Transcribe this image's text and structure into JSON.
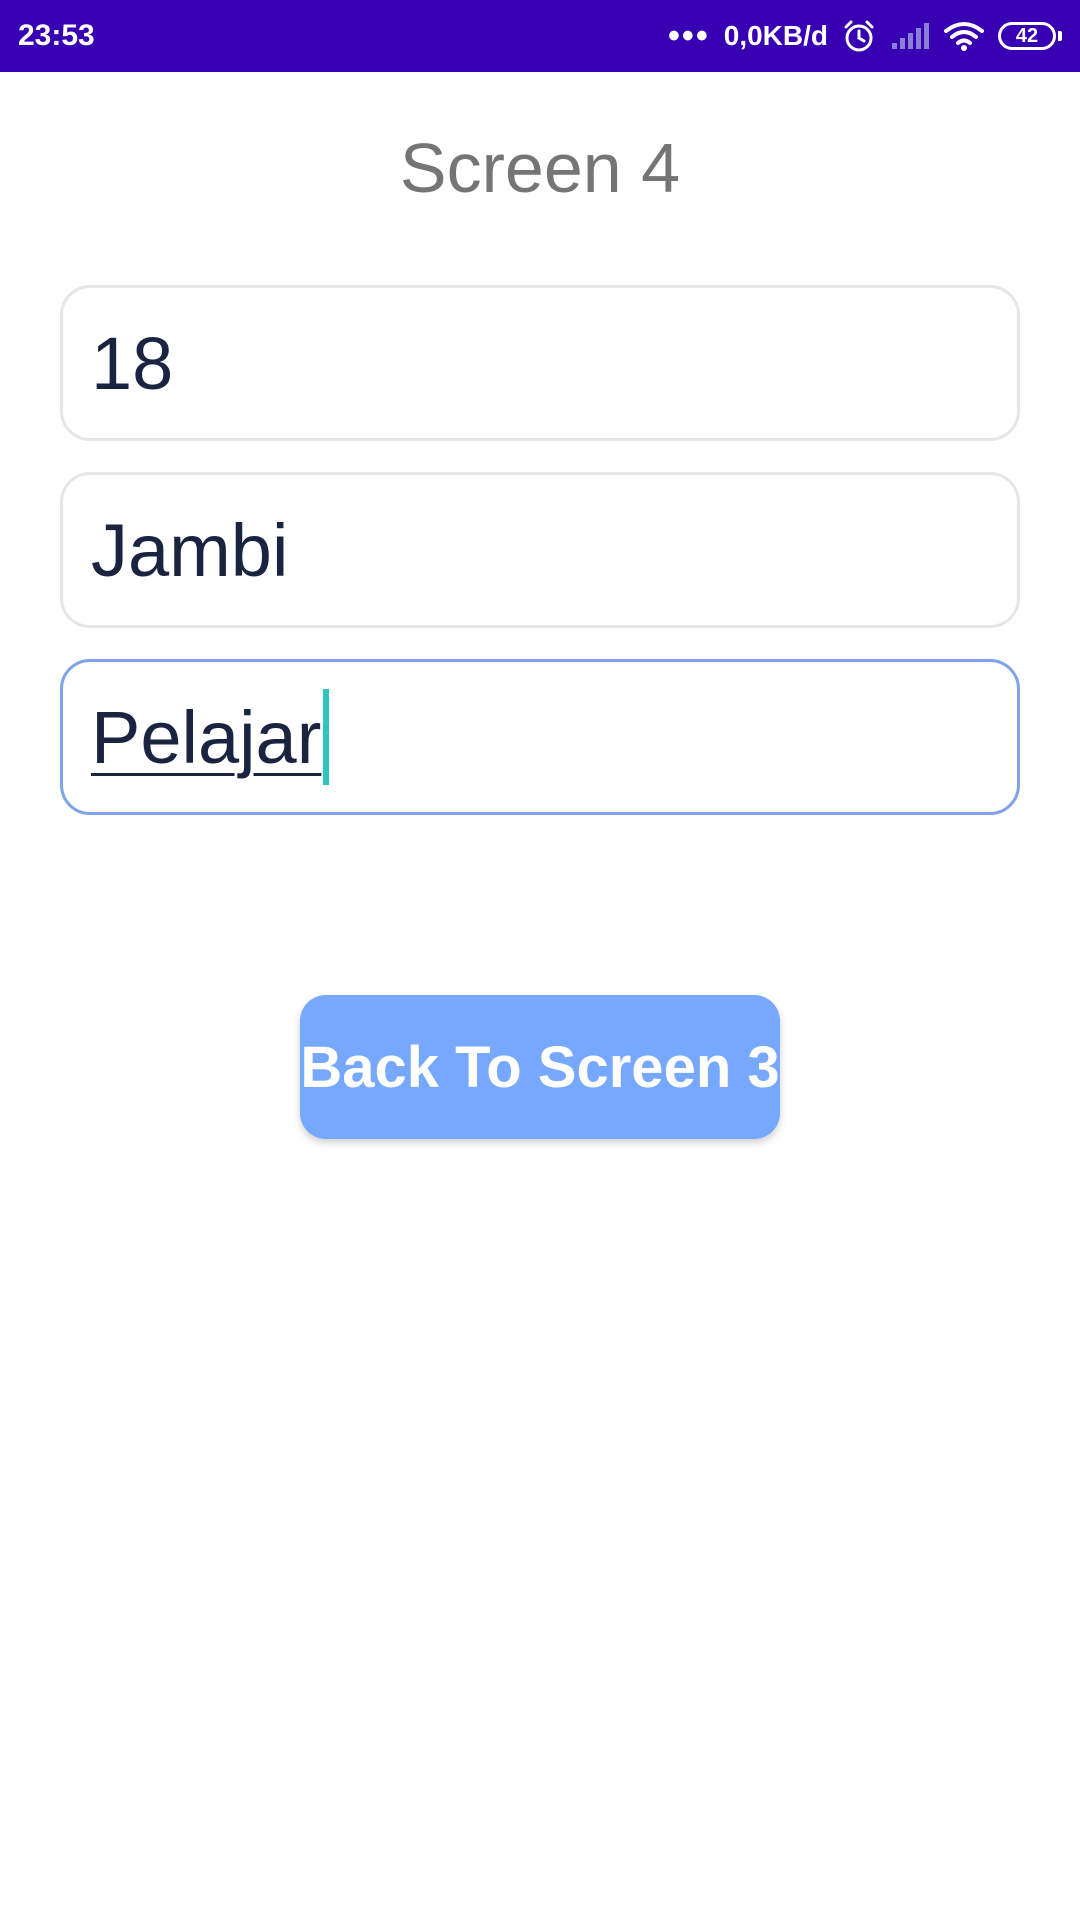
{
  "status_bar": {
    "time": "23:53",
    "dots": "•••",
    "network_speed": "0,0KB/d",
    "battery_level": "42",
    "icons": [
      "alarm-icon",
      "signal-icon",
      "wifi-icon",
      "battery-icon"
    ],
    "background_color": "#3700b3"
  },
  "screen": {
    "title": "Screen 4"
  },
  "form": {
    "fields": [
      {
        "value": "18"
      },
      {
        "value": "Jambi"
      },
      {
        "value": "Pelajar",
        "focused": true
      }
    ],
    "focus_color": "#7ea3e8",
    "cursor_color": "#2ec4c0"
  },
  "actions": {
    "back_button_label": "Back To Screen 3",
    "button_color": "#76a8ff"
  }
}
